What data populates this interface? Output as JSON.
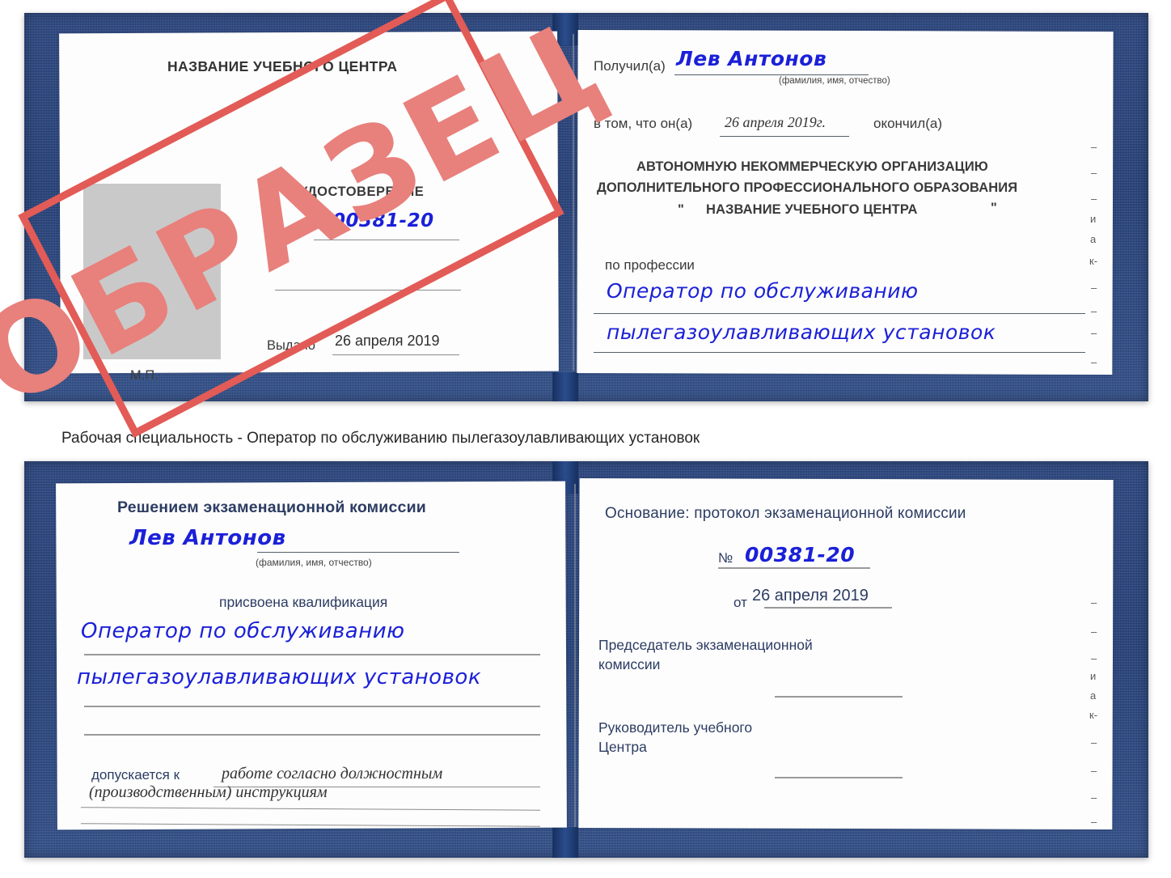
{
  "caption": {
    "text": "Рабочая специальность - Оператор по обслуживанию пылегазоулавливающих установок"
  },
  "colors": {
    "cover_navy": "#1d3a77",
    "stamp_red": "#e25b56",
    "handwriting_blue": "#1b20d8",
    "photo_gray": "#c9c9c9",
    "body_text": "#3a3a3a"
  },
  "stamp": {
    "label": "ОБРАЗЕЦ"
  },
  "certificate_front": {
    "left_page": {
      "org_title": "НАЗВАНИЕ УЧЕБНОГО ЦЕНТРА",
      "doc_type": "УДОСТОВЕРЕНИЕ",
      "number_label": "№",
      "number_value": "00381-20",
      "issued_label": "Выдано",
      "issued_value": "26 апреля 2019",
      "seal_label": "М.П."
    },
    "right_page": {
      "received_label": "Получил(а)",
      "received_value": "Лев Антонов",
      "name_hint": "(фамилия, имя, отчество)",
      "in_that_label": "в том, что он(а)",
      "completion_date": "26 апреля 2019г.",
      "finished_label": "окончил(а)",
      "org_line1": "АВТОНОМНУЮ НЕКОММЕРЧЕСКУЮ ОРГАНИЗАЦИЮ",
      "org_line2": "ДОПОЛНИТЕЛЬНОГО ПРОФЕССИОНАЛЬНОГО ОБРАЗОВАНИЯ",
      "org_quote_open": "\"",
      "org_line3": "НАЗВАНИЕ УЧЕБНОГО ЦЕНТРА",
      "org_quote_close": "\"",
      "profession_label": "по профессии",
      "profession_line1": "Оператор по обслуживанию",
      "profession_line2": "пылегазоулавливающих установок",
      "edge_marks": [
        "–",
        "–",
        "–",
        "и",
        "а",
        "к-",
        "–",
        "–",
        "–",
        "–"
      ]
    }
  },
  "certificate_back": {
    "left_page": {
      "heading": "Решением экзаменационной комиссии",
      "name_value": "Лев Антонов",
      "name_hint": "(фамилия, имя, отчество)",
      "qualification_label": "присвоена квалификация",
      "qualification_line1": "Оператор по обслуживанию",
      "qualification_line2": "пылегазоулавливающих установок",
      "admitted_label": "допускается к",
      "admitted_line1": "работе согласно должностным",
      "admitted_line2": "(производственным) инструкциям"
    },
    "right_page": {
      "basis_label": "Основание: протокол экзаменационной комиссии",
      "number_label": "№",
      "number_value": "00381-20",
      "from_label": "от",
      "from_value": "26 апреля 2019",
      "chairman_line1": "Председатель экзаменационной",
      "chairman_line2": "комиссии",
      "head_line1": "Руководитель учебного",
      "head_line2": "Центра",
      "edge_marks": [
        "–",
        "–",
        "–",
        "и",
        "а",
        "к-",
        "–",
        "–",
        "–",
        "–"
      ]
    }
  }
}
